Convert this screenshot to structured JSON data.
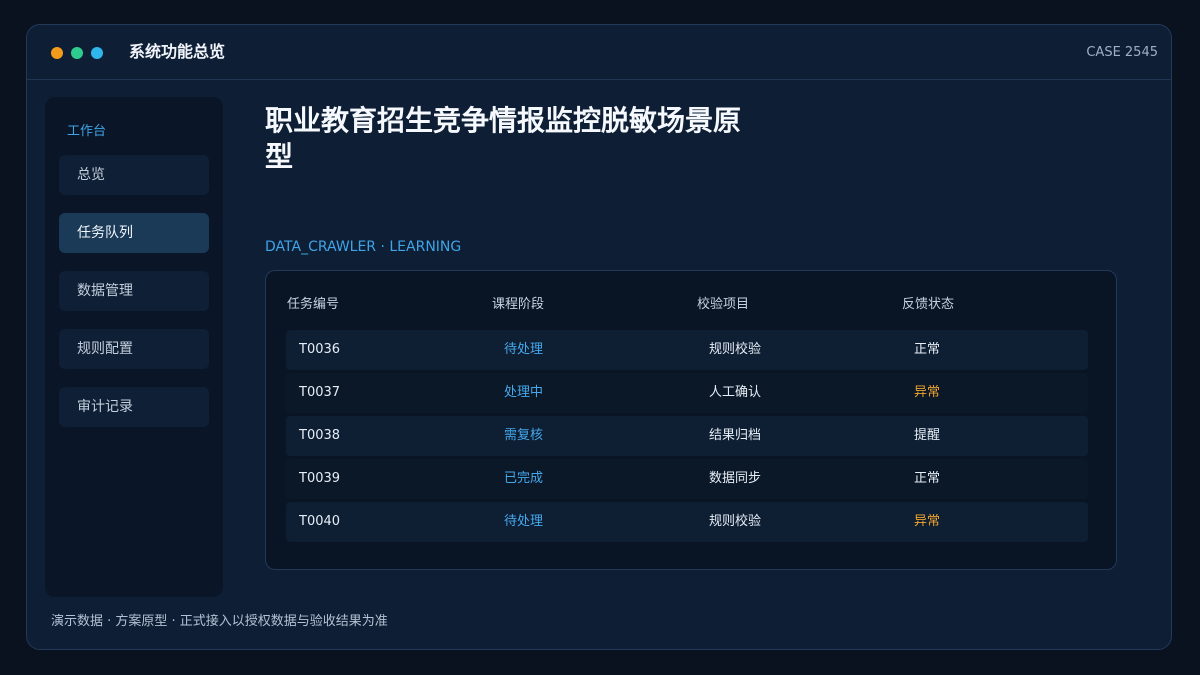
{
  "window": {
    "title": "系统功能总览",
    "case_label": "CASE 2545"
  },
  "sidebar": {
    "heading": "工作台",
    "items": [
      {
        "label": "总览",
        "active": false
      },
      {
        "label": "任务队列",
        "active": true
      },
      {
        "label": "数据管理",
        "active": false
      },
      {
        "label": "规则配置",
        "active": false
      },
      {
        "label": "审计记录",
        "active": false
      }
    ]
  },
  "main": {
    "title": "职业教育招生竞争情报监控脱敏场景原型",
    "section_label": "DATA_CRAWLER · LEARNING",
    "table": {
      "headers": [
        "任务编号",
        "课程阶段",
        "校验项目",
        "反馈状态"
      ],
      "rows": [
        {
          "id": "T0036",
          "stage": "待处理",
          "check": "规则校验",
          "status": "正常"
        },
        {
          "id": "T0037",
          "stage": "处理中",
          "check": "人工确认",
          "status": "异常"
        },
        {
          "id": "T0038",
          "stage": "需复核",
          "check": "结果归档",
          "status": "提醒"
        },
        {
          "id": "T0039",
          "stage": "已完成",
          "check": "数据同步",
          "status": "正常"
        },
        {
          "id": "T0040",
          "stage": "待处理",
          "check": "规则校验",
          "status": "异常"
        }
      ]
    }
  },
  "footer": {
    "note": "演示数据 · 方案原型 · 正式接入以授权数据与验收结果为准"
  },
  "colors": {
    "accent": "#3fa4e8",
    "warning": "#f0a42c",
    "dot_orange": "#f39c1b",
    "dot_green": "#2ecc8f",
    "dot_blue": "#2fb6ec"
  }
}
